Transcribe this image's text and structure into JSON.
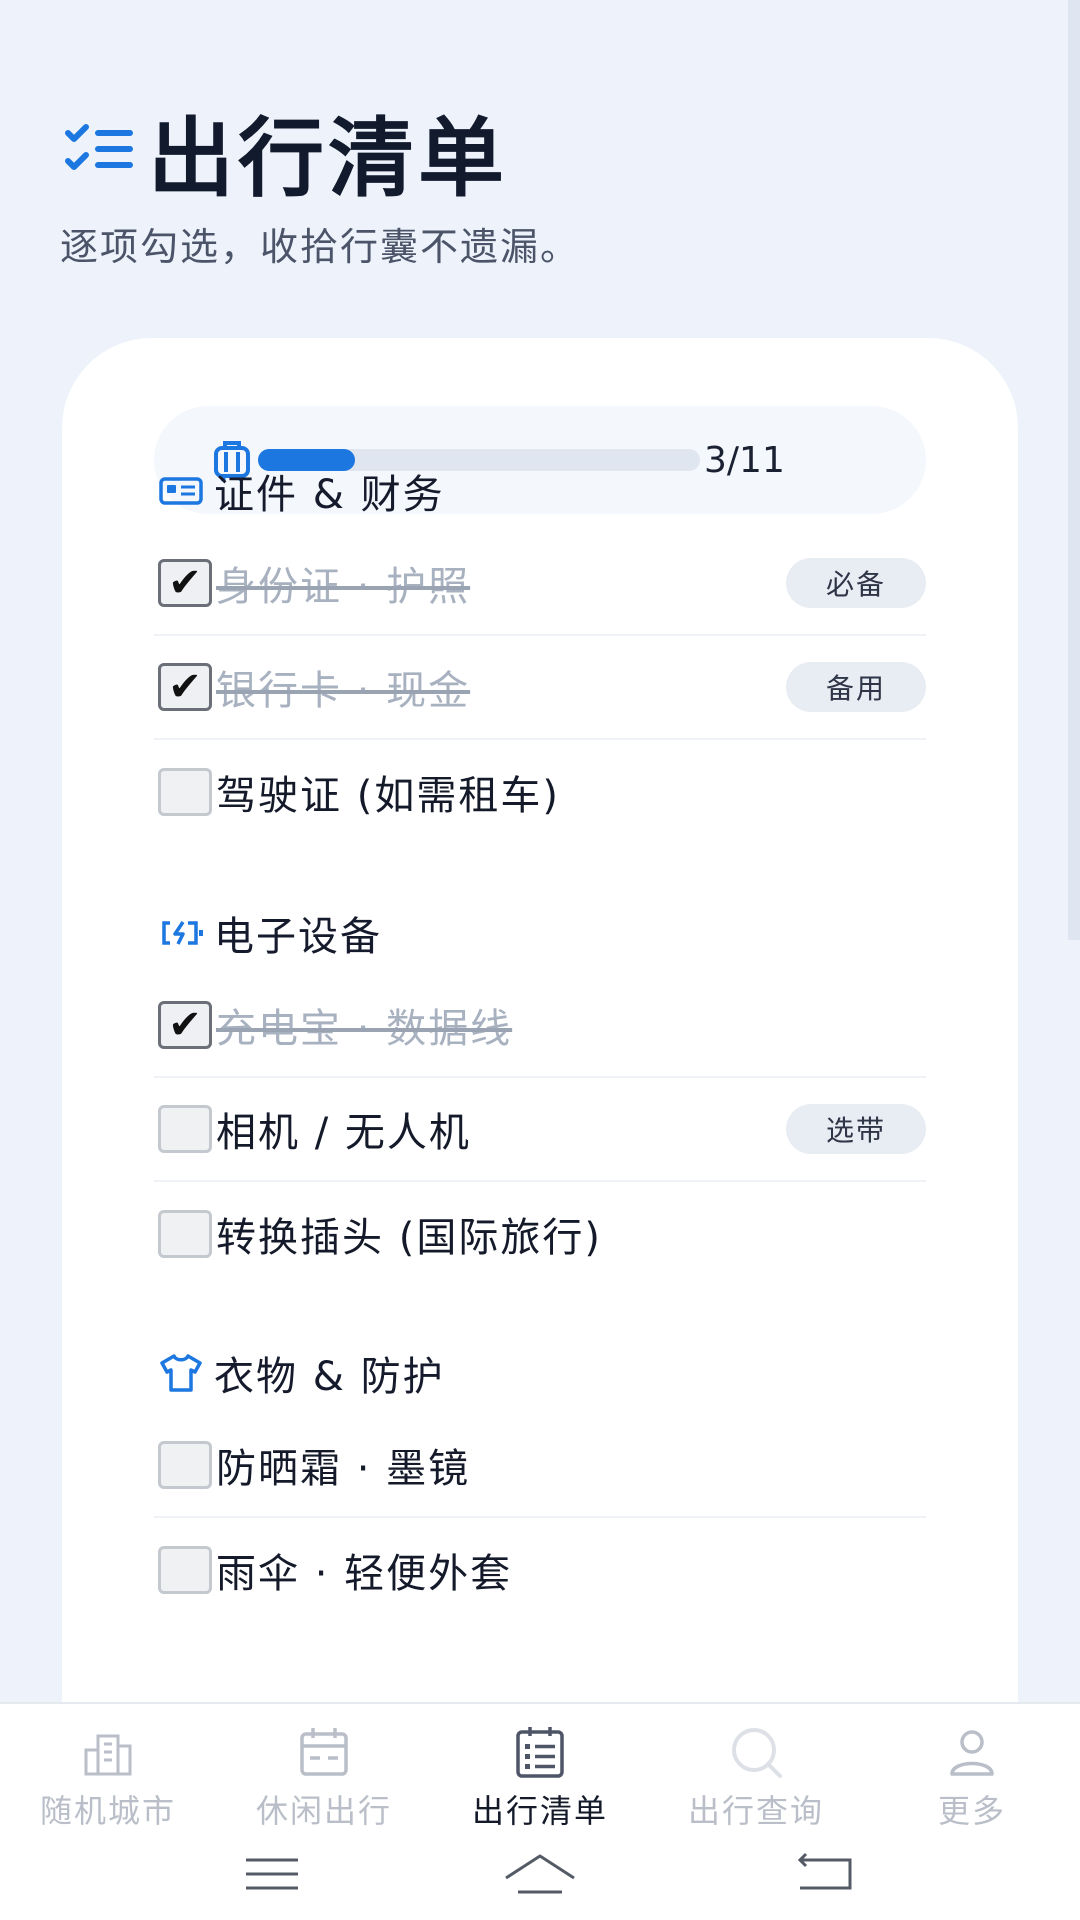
{
  "header": {
    "title": "出行清单",
    "subtitle": "逐项勾选，收拾行囊不遗漏。",
    "icon": "checklist-icon"
  },
  "progress": {
    "done": 3,
    "total": 11,
    "text": "3/11",
    "fraction": 0.22,
    "icon": "luggage-icon"
  },
  "sections": [
    {
      "title": "证件 & 财务",
      "icon": "id-card-icon",
      "items": [
        {
          "label": "身份证 · 护照",
          "checked": true,
          "tag": "必备"
        },
        {
          "label": "银行卡 · 现金",
          "checked": true,
          "tag": "备用"
        },
        {
          "label": "驾驶证 (如需租车)",
          "checked": false,
          "tag": ""
        }
      ]
    },
    {
      "title": "电子设备",
      "icon": "battery-charging-icon",
      "items": [
        {
          "label": "充电宝 · 数据线",
          "checked": true,
          "tag": ""
        },
        {
          "label": "相机 / 无人机",
          "checked": false,
          "tag": "选带"
        },
        {
          "label": "转换插头 (国际旅行)",
          "checked": false,
          "tag": ""
        }
      ]
    },
    {
      "title": "衣物 & 防护",
      "icon": "shirt-icon",
      "items": [
        {
          "label": "防晒霜 · 墨镜",
          "checked": false,
          "tag": ""
        },
        {
          "label": "雨伞 · 轻便外套",
          "checked": false,
          "tag": ""
        }
      ]
    }
  ],
  "tabs": [
    {
      "label": "随机城市",
      "icon": "city-icon",
      "active": false
    },
    {
      "label": "休闲出行",
      "icon": "calendar-icon",
      "active": false
    },
    {
      "label": "出行清单",
      "icon": "checklist-board-icon",
      "active": true
    },
    {
      "label": "出行查询",
      "icon": "search-icon",
      "active": false
    },
    {
      "label": "更多",
      "icon": "user-icon",
      "active": false
    }
  ],
  "colors": {
    "accent": "#1c77e0",
    "background": "#eef3fb",
    "card": "#ffffff",
    "muted_text": "#a8b1bf"
  }
}
